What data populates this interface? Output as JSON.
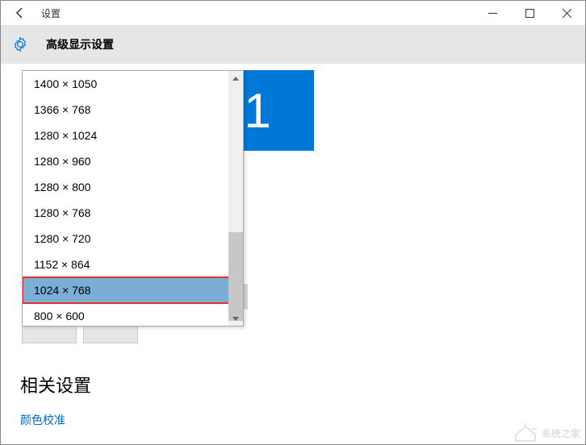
{
  "titlebar": {
    "title": "设置"
  },
  "header": {
    "title": "高级显示设置"
  },
  "monitor": {
    "number": "1"
  },
  "resolution_dropdown": {
    "items": [
      "1400 × 1050",
      "1366 × 768",
      "1280 × 1024",
      "1280 × 960",
      "1280 × 800",
      "1280 × 768",
      "1280 × 720",
      "1152 × 864",
      "1024 × 768",
      "800 × 600"
    ],
    "selected_index": 8,
    "highlighted_index": 8
  },
  "related": {
    "title": "相关设置",
    "links": [
      "颜色校准"
    ]
  },
  "watermark": "系统之家"
}
